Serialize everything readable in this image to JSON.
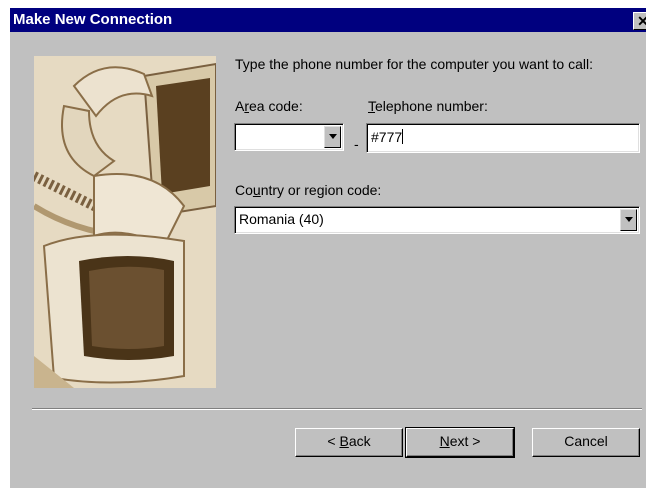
{
  "window": {
    "title": "Make New Connection",
    "close_glyph": "✕"
  },
  "illustration": {
    "icon": "computers-and-phone-illustration",
    "colors": {
      "bg": "#e8ddc8",
      "dark": "#3a2a18",
      "mid": "#9a7a4a",
      "light": "#f0e6d2"
    }
  },
  "form": {
    "prompt": "Type the phone number for the computer you want to call:",
    "area_code": {
      "label_pre": "A",
      "label_accel": "r",
      "label_post": "ea code:",
      "value": ""
    },
    "separator": "-",
    "telephone": {
      "label_pre": "",
      "label_accel": "T",
      "label_post": "elephone number:",
      "value": "#777"
    },
    "country": {
      "label_pre": "Co",
      "label_accel": "u",
      "label_post": "ntry or region code:",
      "value": "Romania (40)"
    }
  },
  "buttons": {
    "back": {
      "pre": "< ",
      "accel": "B",
      "post": "ack"
    },
    "next": {
      "pre": "",
      "accel": "N",
      "post": "ext >"
    },
    "cancel": {
      "label": "Cancel"
    }
  }
}
